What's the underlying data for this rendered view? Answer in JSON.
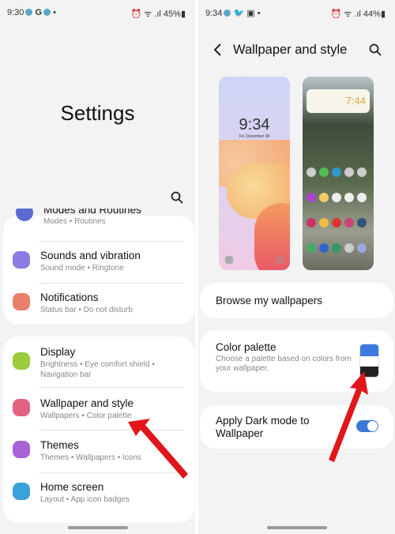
{
  "left": {
    "status": {
      "time": "9:30",
      "battery": "45%"
    },
    "title": "Settings",
    "items": [
      {
        "title": "Modes and Routines",
        "subtitle": "Modes • Routines",
        "color": "#5b6ad0"
      },
      {
        "title": "Sounds and vibration",
        "subtitle": "Sound mode • Ringtone",
        "color": "#8b7ce2"
      },
      {
        "title": "Notifications",
        "subtitle": "Status bar • Do not disturb",
        "color": "#e8806c"
      },
      {
        "title": "Display",
        "subtitle": "Brightness • Eye comfort shield • Navigation bar",
        "color": "#9ccb3e"
      },
      {
        "title": "Wallpaper and style",
        "subtitle": "Wallpapers • Color palette",
        "color": "#e2627f"
      },
      {
        "title": "Themes",
        "subtitle": "Themes • Wallpapers • Icons",
        "color": "#a862d6"
      },
      {
        "title": "Home screen",
        "subtitle": "Layout • App icon badges",
        "color": "#3aa2d8"
      }
    ]
  },
  "right": {
    "status": {
      "time": "9:34",
      "battery": "44%"
    },
    "title": "Wallpaper and style",
    "lock_preview": {
      "time": "9:34",
      "date": "Fri, December 30"
    },
    "home_preview": {
      "time": "7:44"
    },
    "browse_label": "Browse my wallpapers",
    "palette": {
      "title": "Color palette",
      "subtitle": "Choose a palette based on colors from your wallpaper.",
      "colors": [
        "#3b7be0",
        "#ffffff",
        "#222222"
      ]
    },
    "dark_mode": {
      "label": "Apply Dark mode to Wallpaper",
      "on": true,
      "color": "#3a78d8"
    }
  },
  "accent_arrow": "#e0161b"
}
